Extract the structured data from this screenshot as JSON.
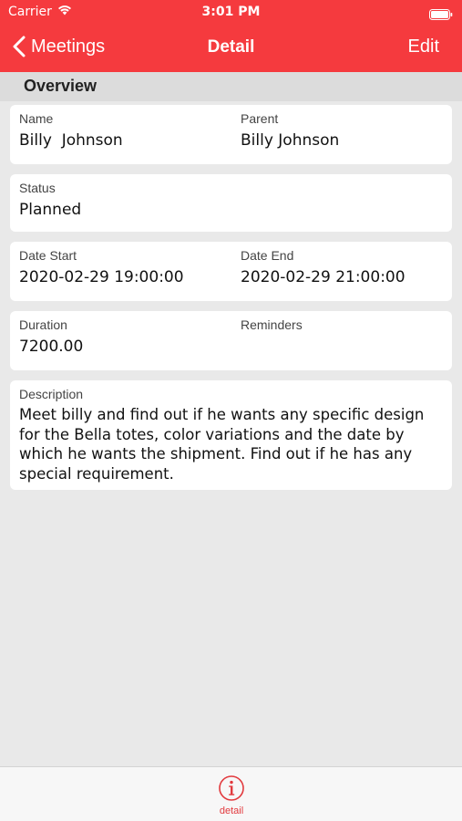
{
  "status_bar": {
    "carrier": "Carrier",
    "time": "3:01 PM"
  },
  "nav": {
    "back_label": "Meetings",
    "title": "Detail",
    "edit_label": "Edit"
  },
  "section": {
    "title": "Overview"
  },
  "fields": {
    "name": {
      "label": "Name",
      "value": "Billy  Johnson"
    },
    "parent": {
      "label": "Parent",
      "value": "Billy Johnson"
    },
    "status": {
      "label": "Status",
      "value": "Planned"
    },
    "date_start": {
      "label": "Date Start",
      "value": "2020-02-29 19:00:00"
    },
    "date_end": {
      "label": "Date End",
      "value": "2020-02-29 21:00:00"
    },
    "duration": {
      "label": "Duration",
      "value": "7200.00"
    },
    "reminders": {
      "label": "Reminders",
      "value": ""
    },
    "description": {
      "label": "Description",
      "value": "Meet billy and find out if he wants any specific design for the Bella totes, color variations and the date by which he wants the shipment. Find out if he has any special requirement."
    }
  },
  "tabbar": {
    "items": [
      {
        "label": "detail",
        "icon": "info-icon",
        "active": true
      }
    ]
  },
  "colors": {
    "accent": "#f53a3e",
    "background": "#e9e9e9",
    "card": "#ffffff"
  }
}
